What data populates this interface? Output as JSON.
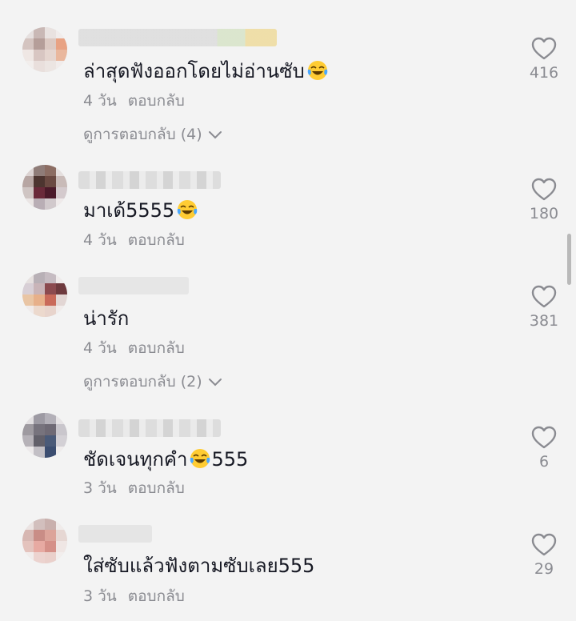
{
  "comments": [
    {
      "text": "ล่าสุดฟังออกโดยไม่อ่านซับ",
      "time": "4 วัน",
      "reply_label": "ตอบกลับ",
      "view_replies": "ดูการตอบกลับ (4)",
      "likes": "416"
    },
    {
      "text": "มาเด้5555",
      "time": "4 วัน",
      "reply_label": "ตอบกลับ",
      "likes": "180"
    },
    {
      "text": "น่ารัก",
      "time": "4 วัน",
      "reply_label": "ตอบกลับ",
      "view_replies": "ดูการตอบกลับ (2)",
      "likes": "381"
    },
    {
      "text_before": "ชัดเจนทุกคำ",
      "text_after": "555",
      "time": "3 วัน",
      "reply_label": "ตอบกลับ",
      "likes": "6"
    },
    {
      "text": "ใส่ซับแล้วฟังตามซับเลย555",
      "time": "3 วัน",
      "reply_label": "ตอบกลับ",
      "likes": "29"
    }
  ],
  "icons": {
    "like": "heart-outline-icon",
    "emoji": "face-with-tears-of-joy-icon",
    "expand": "chevron-down-icon"
  },
  "colors": {
    "background": "#f3f3f3",
    "text": "#161823",
    "secondary": "#8a8b91"
  }
}
